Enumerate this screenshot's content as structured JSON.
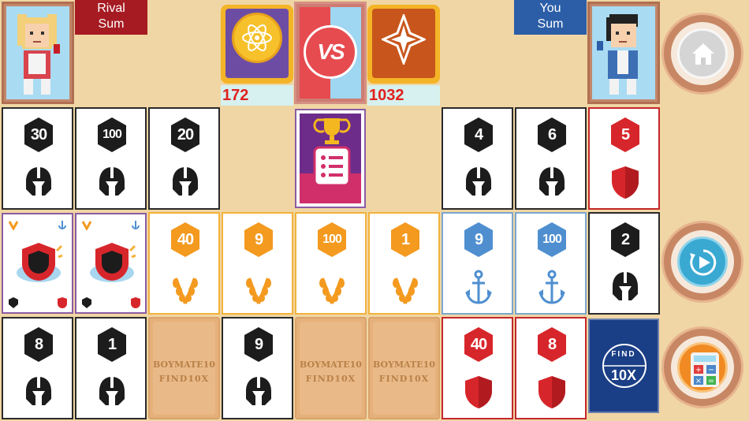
{
  "header": {
    "rival_label": "Rival\nSum",
    "you_label": "You\nSum",
    "vs_label": "VS",
    "rival_score": "172",
    "you_score": "1032"
  },
  "slot_text": {
    "line1": "BOYMATE10",
    "line2": "FIND10X"
  },
  "deck_text": {
    "line1": "FIND",
    "line2": "10X"
  },
  "row1": [
    {
      "value": "30",
      "suit": "helmet",
      "color": "black"
    },
    {
      "value": "100",
      "suit": "helmet",
      "color": "black"
    },
    {
      "value": "20",
      "suit": "helmet",
      "color": "black"
    },
    {
      "value": "4",
      "suit": "helmet",
      "color": "black"
    },
    {
      "value": "6",
      "suit": "helmet",
      "color": "black"
    },
    {
      "value": "5",
      "suit": "shield",
      "color": "red"
    }
  ],
  "row2": [
    {
      "value": "40",
      "suit": "wheat",
      "color": "orange"
    },
    {
      "value": "9",
      "suit": "wheat",
      "color": "orange"
    },
    {
      "value": "100",
      "suit": "wheat",
      "color": "orange"
    },
    {
      "value": "1",
      "suit": "wheat",
      "color": "orange"
    },
    {
      "value": "9",
      "suit": "anchor",
      "color": "blue"
    },
    {
      "value": "100",
      "suit": "anchor",
      "color": "blue"
    },
    {
      "value": "2",
      "suit": "helmet",
      "color": "black"
    }
  ],
  "row3": [
    {
      "value": "8",
      "suit": "helmet",
      "color": "black"
    },
    {
      "value": "1",
      "suit": "helmet",
      "color": "black"
    },
    {
      "value": "9",
      "suit": "helmet",
      "color": "black"
    },
    {
      "value": "40",
      "suit": "shield",
      "color": "red"
    },
    {
      "value": "8",
      "suit": "shield",
      "color": "red"
    }
  ],
  "colors": {
    "black": "#1c1c1c",
    "red": "#d7262b",
    "orange": "#f39a1f",
    "blue": "#4f8fd0",
    "background": "#f0d6a4"
  },
  "buttons": {
    "home": "home-icon",
    "play": "replay-icon",
    "calc": "calculator-icon"
  }
}
